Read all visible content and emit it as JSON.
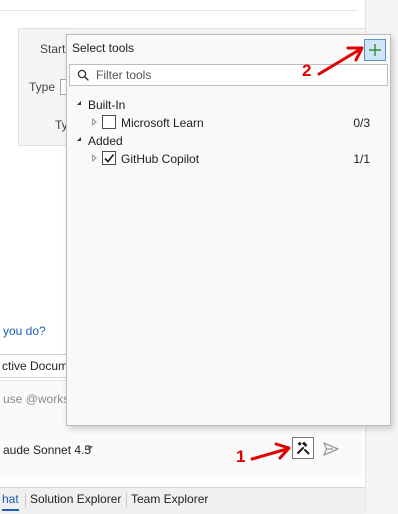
{
  "background": {
    "form": {
      "start_label": "Start",
      "type_label": "Type",
      "type_cut_label": "Ty"
    },
    "prompt_link": "you do?",
    "document_chip": "ctive Docum",
    "input_placeholder": "use @worksp",
    "model_selector": "aude Sonnet 4.5"
  },
  "select_tools": {
    "title": "Select tools",
    "filter_placeholder": "Filter tools",
    "groups": [
      {
        "label": "Built-In",
        "tools": [
          {
            "label": "Microsoft Learn",
            "count": "0/3",
            "checked": false
          }
        ]
      },
      {
        "label": "Added",
        "tools": [
          {
            "label": "GitHub Copilot",
            "count": "1/1",
            "checked": true
          }
        ]
      }
    ]
  },
  "tabs": [
    {
      "label": "hat",
      "active": true
    },
    {
      "label": "Solution Explorer",
      "active": false
    },
    {
      "label": "Team Explorer",
      "active": false
    }
  ],
  "annotations": {
    "marker_1": "1",
    "marker_2": "2",
    "color": "#e00000"
  },
  "icons": {
    "add_tool": "plus-icon",
    "tools": "tools-icon",
    "send": "send-icon",
    "filter": "search-icon"
  },
  "colors": {
    "accent": "#1a5fb4",
    "add_button_bg": "#cfe4f7",
    "popup_bg": "#f9f9f9"
  }
}
